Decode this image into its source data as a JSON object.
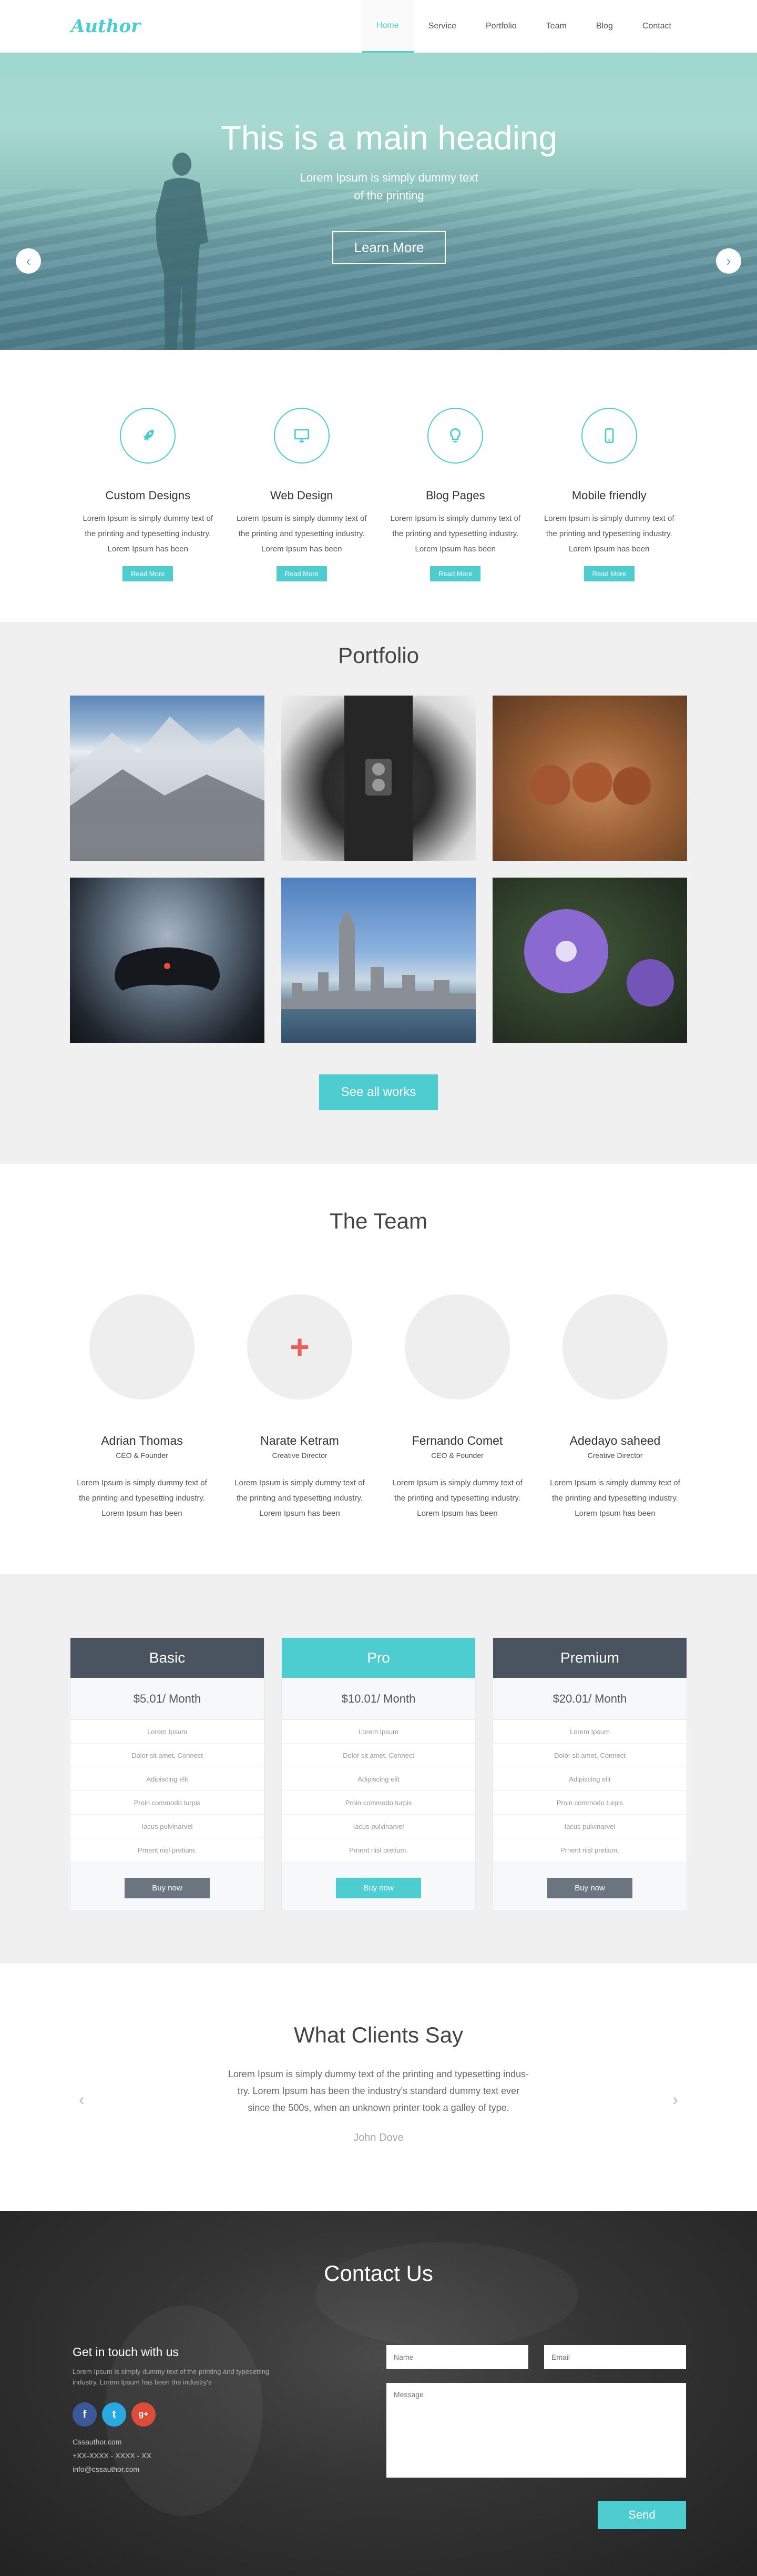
{
  "nav": {
    "logo": "Author",
    "items": [
      {
        "label": "Home"
      },
      {
        "label": "Service"
      },
      {
        "label": "Portfolio"
      },
      {
        "label": "Team"
      },
      {
        "label": "Blog"
      },
      {
        "label": "Contact"
      }
    ],
    "active": "Home"
  },
  "hero": {
    "heading": "This is a main heading",
    "subline1": "Lorem Ipsum is simply dummy text",
    "subline2": "of the printing",
    "button": "Learn More",
    "prev_icon": "chevron-left-icon",
    "next_icon": "chevron-right-icon"
  },
  "services": [
    {
      "icon": "rocket-icon",
      "title": "Custom Designs",
      "line1": "Lorem Ipsum is simply dummy text of",
      "line2": "the printing and typesetting industry.",
      "line3": "Lorem Ipsum has been",
      "button": "Read More"
    },
    {
      "icon": "monitor-icon",
      "title": "Web Design",
      "line1": "Lorem Ipsum is simply dummy text of",
      "line2": "the printing and typesetting industry.",
      "line3": "Lorem Ipsum has been",
      "button": "Read More"
    },
    {
      "icon": "lightbulb-icon",
      "title": "Blog Pages",
      "line1": "Lorem Ipsum is simply dummy text of",
      "line2": "the printing and typesetting industry.",
      "line3": "Lorem Ipsum has been",
      "button": "Read More"
    },
    {
      "icon": "mobile-icon",
      "title": "Mobile friendly",
      "line1": "Lorem Ipsum is simply dummy text of",
      "line2": "the printing and typesetting industry.",
      "line3": "Lorem Ipsum has been",
      "button": "Read More"
    }
  ],
  "portfolio": {
    "title": "Portfolio",
    "button": "See all works"
  },
  "team": {
    "title": "The Team",
    "members": [
      {
        "name": "Adrian Thomas",
        "role": "CEO & Founder",
        "line1": "Lorem Ipsum is simply dummy text of",
        "line2": "the printing and typesetting industry.",
        "line3": "Lorem Ipsum has been"
      },
      {
        "name": "Narate Ketram",
        "role": "Creative Director",
        "line1": "Lorem Ipsum is simply dummy text of",
        "line2": "the printing and typesetting industry.",
        "line3": "Lorem Ipsum has been"
      },
      {
        "name": "Fernando Comet",
        "role": "CEO & Founder",
        "line1": "Lorem Ipsum is simply dummy text of",
        "line2": "the printing and typesetting industry.",
        "line3": "Lorem Ipsum has been"
      },
      {
        "name": "Adedayo saheed",
        "role": "Creative Director",
        "line1": "Lorem Ipsum is simply dummy text of",
        "line2": "the printing and typesetting industry.",
        "line3": "Lorem Ipsum has been"
      }
    ]
  },
  "pricing": [
    {
      "name": "Basic",
      "price": "$5.01/ Month",
      "features": [
        "Lorem Ipsum",
        "Dolor sit amet, Connect",
        "Adipiscing elit",
        "Proin commodo turpis",
        "Iacus pulvinarvel",
        "Prnent nisl pretium."
      ],
      "button": "Buy now"
    },
    {
      "name": "Pro",
      "price": "$10.01/ Month",
      "features": [
        "Lorem Ipsum",
        "Dolor sit amet, Connect",
        "Adipiscing elit",
        "Proin commodo turpis",
        "Iacus pulvinarvel",
        "Prnent nisl pretium."
      ],
      "button": "Buy now"
    },
    {
      "name": "Premium",
      "price": "$20.01/ Month",
      "features": [
        "Lorem Ipsum",
        "Dolor sit amet, Connect",
        "Adipiscing elit",
        "Proin commodo turpis",
        "Iacus pulvinarvel",
        "Prnent nisl pretium."
      ],
      "button": "Buy now"
    }
  ],
  "clients": {
    "title": "What Clients Say",
    "line1": "Lorem Ipsum is simply dummy text of the printing and typesetting indus-",
    "line2": "try. Lorem Ipsum has been the industry's standard dummy text ever",
    "line3": "since the 500s, when an unknown printer took a galley of type.",
    "author": "John Dove"
  },
  "contact": {
    "title": "Contact Us",
    "heading": "Get in touch with us",
    "small1": "Lorem Ipsum is simply dummy text of the printing and typesetting",
    "small2": "industry. Lorem Ipsum has been the industry's",
    "website": "Cssauthor.com",
    "phone": "+XX-XXXX - XXXX - XX",
    "email": "info@cssauthor.com",
    "name_placeholder": "Name",
    "email_placeholder": "Email",
    "message_placeholder": "Message",
    "send": "Send"
  },
  "colors": {
    "accent": "#4ecdd1",
    "dark": "#4a5460",
    "facebook": "#3b5998",
    "twitter": "#29a9e1",
    "googleplus": "#dd4b39"
  }
}
